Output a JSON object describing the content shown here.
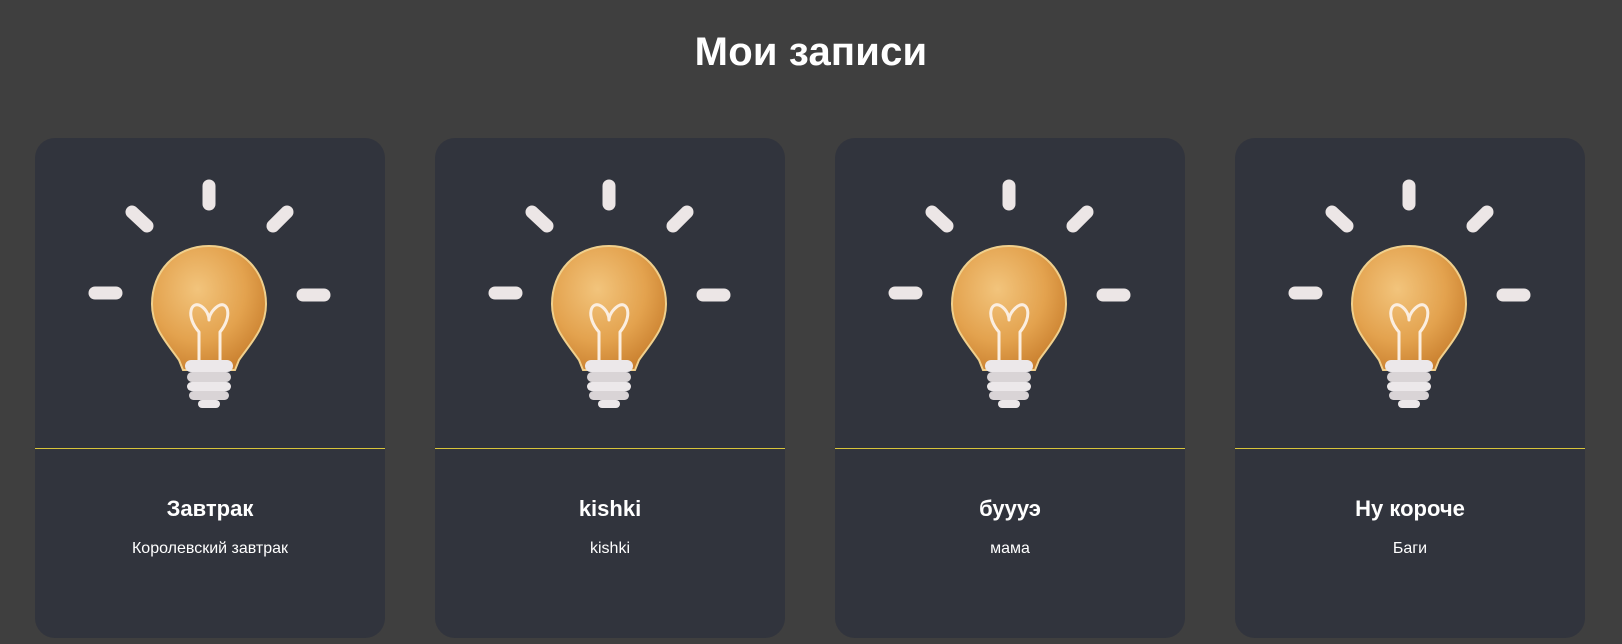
{
  "header": {
    "title": "Мои записи"
  },
  "cards": [
    {
      "title": "Завтрак",
      "text": "Королевский завтрак",
      "icon": "lightbulb-icon"
    },
    {
      "title": "kishki",
      "text": "kishki",
      "icon": "lightbulb-icon"
    },
    {
      "title": "буууэ",
      "text": "мама",
      "icon": "lightbulb-icon"
    },
    {
      "title": "Ну короче",
      "text": "Баги",
      "icon": "lightbulb-icon"
    }
  ],
  "colors": {
    "background": "#3f3f3f",
    "card": "#31343d",
    "divider": "#d8c43a",
    "bulb": "#e2a650",
    "rays": "#e8e1e1"
  }
}
